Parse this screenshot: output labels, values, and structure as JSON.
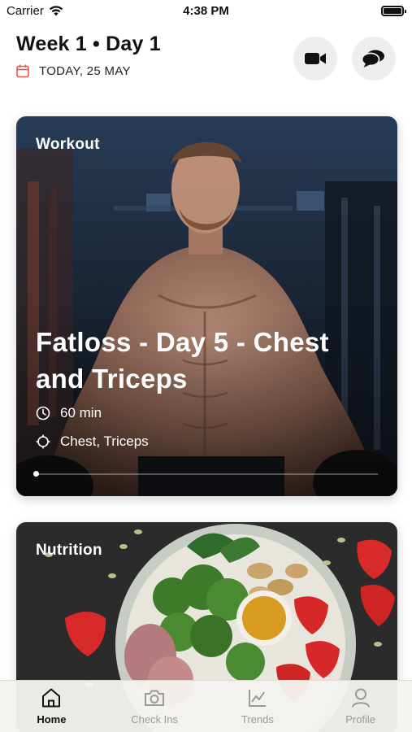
{
  "status_bar": {
    "carrier": "Carrier",
    "time": "4:38 PM"
  },
  "header": {
    "title": "Week 1 • Day 1",
    "date": "TODAY, 25 MAY",
    "accent_color": "#e8554e"
  },
  "workout_card": {
    "label": "Workout",
    "title": "Fatloss - Day 5 - Chest and Triceps",
    "duration": "60 min",
    "muscles": "Chest, Triceps",
    "progress": 0
  },
  "nutrition_card": {
    "label": "Nutrition"
  },
  "tabs": [
    {
      "label": "Home",
      "icon": "home-icon",
      "active": true
    },
    {
      "label": "Check Ins",
      "icon": "camera-icon",
      "active": false
    },
    {
      "label": "Trends",
      "icon": "chart-icon",
      "active": false
    },
    {
      "label": "Profile",
      "icon": "profile-icon",
      "active": false
    }
  ]
}
